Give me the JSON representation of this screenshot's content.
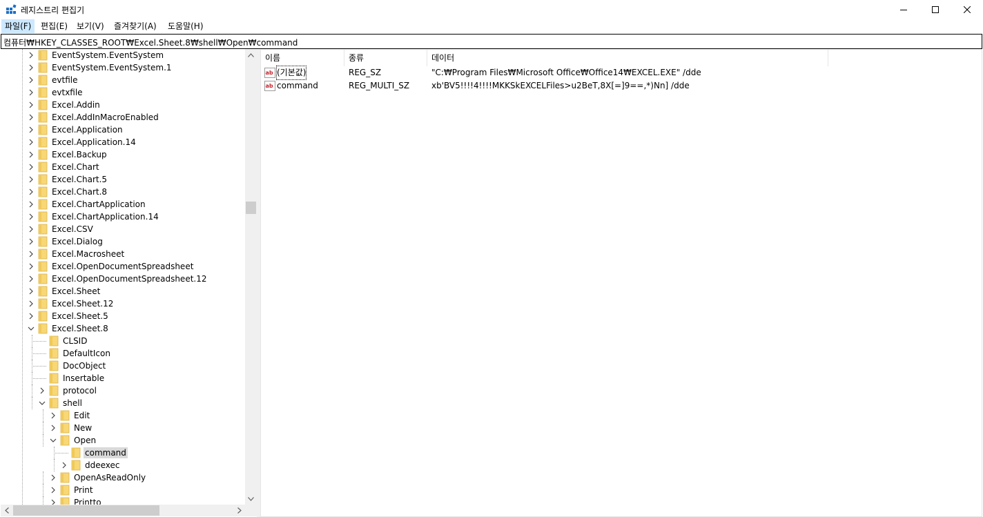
{
  "window": {
    "title": "레지스트리 편집기",
    "icon": "registry-editor-icon"
  },
  "menu": {
    "file": "파일(F)",
    "edit": "편집(E)",
    "view": "보기(V)",
    "favorites": "즐겨찾기(A)",
    "help": "도움말(H)"
  },
  "address": {
    "path": "컴퓨터₩HKEY_CLASSES_ROOT₩Excel.Sheet.8₩shell₩Open₩command"
  },
  "tree": {
    "items": [
      {
        "label": "EventSystem.EventSystem",
        "level": 0,
        "expander": "collapsed"
      },
      {
        "label": "EventSystem.EventSystem.1",
        "level": 0,
        "expander": "collapsed"
      },
      {
        "label": "evtfile",
        "level": 0,
        "expander": "collapsed"
      },
      {
        "label": "evtxfile",
        "level": 0,
        "expander": "collapsed"
      },
      {
        "label": "Excel.Addin",
        "level": 0,
        "expander": "collapsed"
      },
      {
        "label": "Excel.AddInMacroEnabled",
        "level": 0,
        "expander": "collapsed"
      },
      {
        "label": "Excel.Application",
        "level": 0,
        "expander": "collapsed"
      },
      {
        "label": "Excel.Application.14",
        "level": 0,
        "expander": "collapsed"
      },
      {
        "label": "Excel.Backup",
        "level": 0,
        "expander": "collapsed"
      },
      {
        "label": "Excel.Chart",
        "level": 0,
        "expander": "collapsed"
      },
      {
        "label": "Excel.Chart.5",
        "level": 0,
        "expander": "collapsed"
      },
      {
        "label": "Excel.Chart.8",
        "level": 0,
        "expander": "collapsed"
      },
      {
        "label": "Excel.ChartApplication",
        "level": 0,
        "expander": "collapsed"
      },
      {
        "label": "Excel.ChartApplication.14",
        "level": 0,
        "expander": "collapsed"
      },
      {
        "label": "Excel.CSV",
        "level": 0,
        "expander": "collapsed"
      },
      {
        "label": "Excel.Dialog",
        "level": 0,
        "expander": "collapsed"
      },
      {
        "label": "Excel.Macrosheet",
        "level": 0,
        "expander": "collapsed"
      },
      {
        "label": "Excel.OpenDocumentSpreadsheet",
        "level": 0,
        "expander": "collapsed"
      },
      {
        "label": "Excel.OpenDocumentSpreadsheet.12",
        "level": 0,
        "expander": "collapsed"
      },
      {
        "label": "Excel.Sheet",
        "level": 0,
        "expander": "collapsed"
      },
      {
        "label": "Excel.Sheet.12",
        "level": 0,
        "expander": "collapsed"
      },
      {
        "label": "Excel.Sheet.5",
        "level": 0,
        "expander": "collapsed"
      },
      {
        "label": "Excel.Sheet.8",
        "level": 0,
        "expander": "expanded"
      },
      {
        "label": "CLSID",
        "level": 1,
        "expander": "none"
      },
      {
        "label": "DefaultIcon",
        "level": 1,
        "expander": "none"
      },
      {
        "label": "DocObject",
        "level": 1,
        "expander": "none"
      },
      {
        "label": "Insertable",
        "level": 1,
        "expander": "none"
      },
      {
        "label": "protocol",
        "level": 1,
        "expander": "collapsed"
      },
      {
        "label": "shell",
        "level": 1,
        "expander": "expanded"
      },
      {
        "label": "Edit",
        "level": 2,
        "expander": "collapsed"
      },
      {
        "label": "New",
        "level": 2,
        "expander": "collapsed"
      },
      {
        "label": "Open",
        "level": 2,
        "expander": "expanded"
      },
      {
        "label": "command",
        "level": 3,
        "expander": "none",
        "selected": true
      },
      {
        "label": "ddeexec",
        "level": 3,
        "expander": "collapsed"
      },
      {
        "label": "OpenAsReadOnly",
        "level": 2,
        "expander": "collapsed"
      },
      {
        "label": "Print",
        "level": 2,
        "expander": "collapsed"
      },
      {
        "label": "Printto",
        "level": 2,
        "expander": "collapsed"
      }
    ]
  },
  "list": {
    "columns": {
      "name": "이름",
      "type": "종류",
      "data": "데이터"
    },
    "rows": [
      {
        "name": "(기본값)",
        "type": "REG_SZ",
        "data": "\"C:₩Program Files₩Microsoft Office₩Office14₩EXCEL.EXE\" /dde",
        "icon": "string-value-icon"
      },
      {
        "name": "command",
        "type": "REG_MULTI_SZ",
        "data": "xb'BV5!!!!4!!!!MKKSkEXCELFiles>u2BeT,8X[=]9==,*)Nn] /dde",
        "icon": "string-value-icon"
      }
    ]
  },
  "colors": {
    "menu_active": "#cce8ff",
    "tree_selected": "#d9d9d9",
    "folder": "#f8d775",
    "value_icon_red": "#c4262e"
  }
}
